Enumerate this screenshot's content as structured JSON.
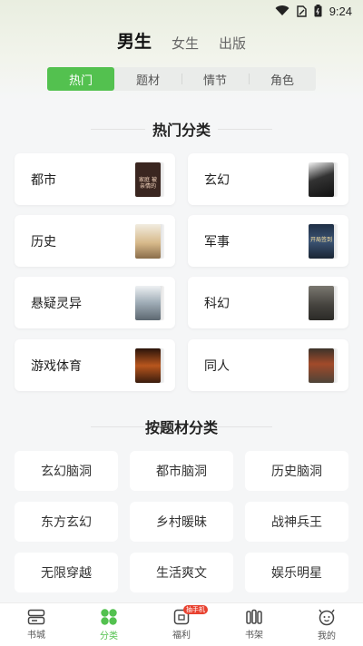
{
  "status_bar": {
    "time": "9:24"
  },
  "gender_tabs": [
    {
      "label": "男生",
      "active": true
    },
    {
      "label": "女生",
      "active": false
    },
    {
      "label": "出版",
      "active": false
    }
  ],
  "sub_tabs": [
    {
      "label": "热门",
      "active": true
    },
    {
      "label": "题材",
      "active": false
    },
    {
      "label": "情节",
      "active": false
    },
    {
      "label": "角色",
      "active": false
    }
  ],
  "hot_section": {
    "title": "热门分类",
    "categories": [
      {
        "label": "都市",
        "cover_color": "#3a2620",
        "cover_text": "家庭 被亲情的"
      },
      {
        "label": "玄幻",
        "cover_color": "#1c1c1c",
        "cover_text": ""
      },
      {
        "label": "历史",
        "cover_color": "#e9e1cf",
        "cover_text": ""
      },
      {
        "label": "军事",
        "cover_color": "#2b3d55",
        "cover_text": "开局签到"
      },
      {
        "label": "悬疑灵异",
        "cover_color": "#c9cfd4",
        "cover_text": ""
      },
      {
        "label": "科幻",
        "cover_color": "#4a4a48",
        "cover_text": ""
      },
      {
        "label": "游戏体育",
        "cover_color": "#3a1c0e",
        "cover_text": ""
      },
      {
        "label": "同人",
        "cover_color": "#5a4a3c",
        "cover_text": ""
      }
    ]
  },
  "theme_section": {
    "title": "按题材分类",
    "chips": [
      "玄幻脑洞",
      "都市脑洞",
      "历史脑洞",
      "东方玄幻",
      "乡村暖昧",
      "战神兵王",
      "无限穿越",
      "生活爽文",
      "娱乐明星"
    ]
  },
  "bottom_nav": [
    {
      "label": "书城",
      "icon": "bookstore-icon",
      "active": false
    },
    {
      "label": "分类",
      "icon": "category-icon",
      "active": true
    },
    {
      "label": "福利",
      "icon": "welfare-icon",
      "active": false,
      "badge": "抽手机"
    },
    {
      "label": "书架",
      "icon": "bookshelf-icon",
      "active": false
    },
    {
      "label": "我的",
      "icon": "profile-icon",
      "active": false
    }
  ],
  "colors": {
    "accent": "#53c14f",
    "badge": "#e8412f"
  }
}
